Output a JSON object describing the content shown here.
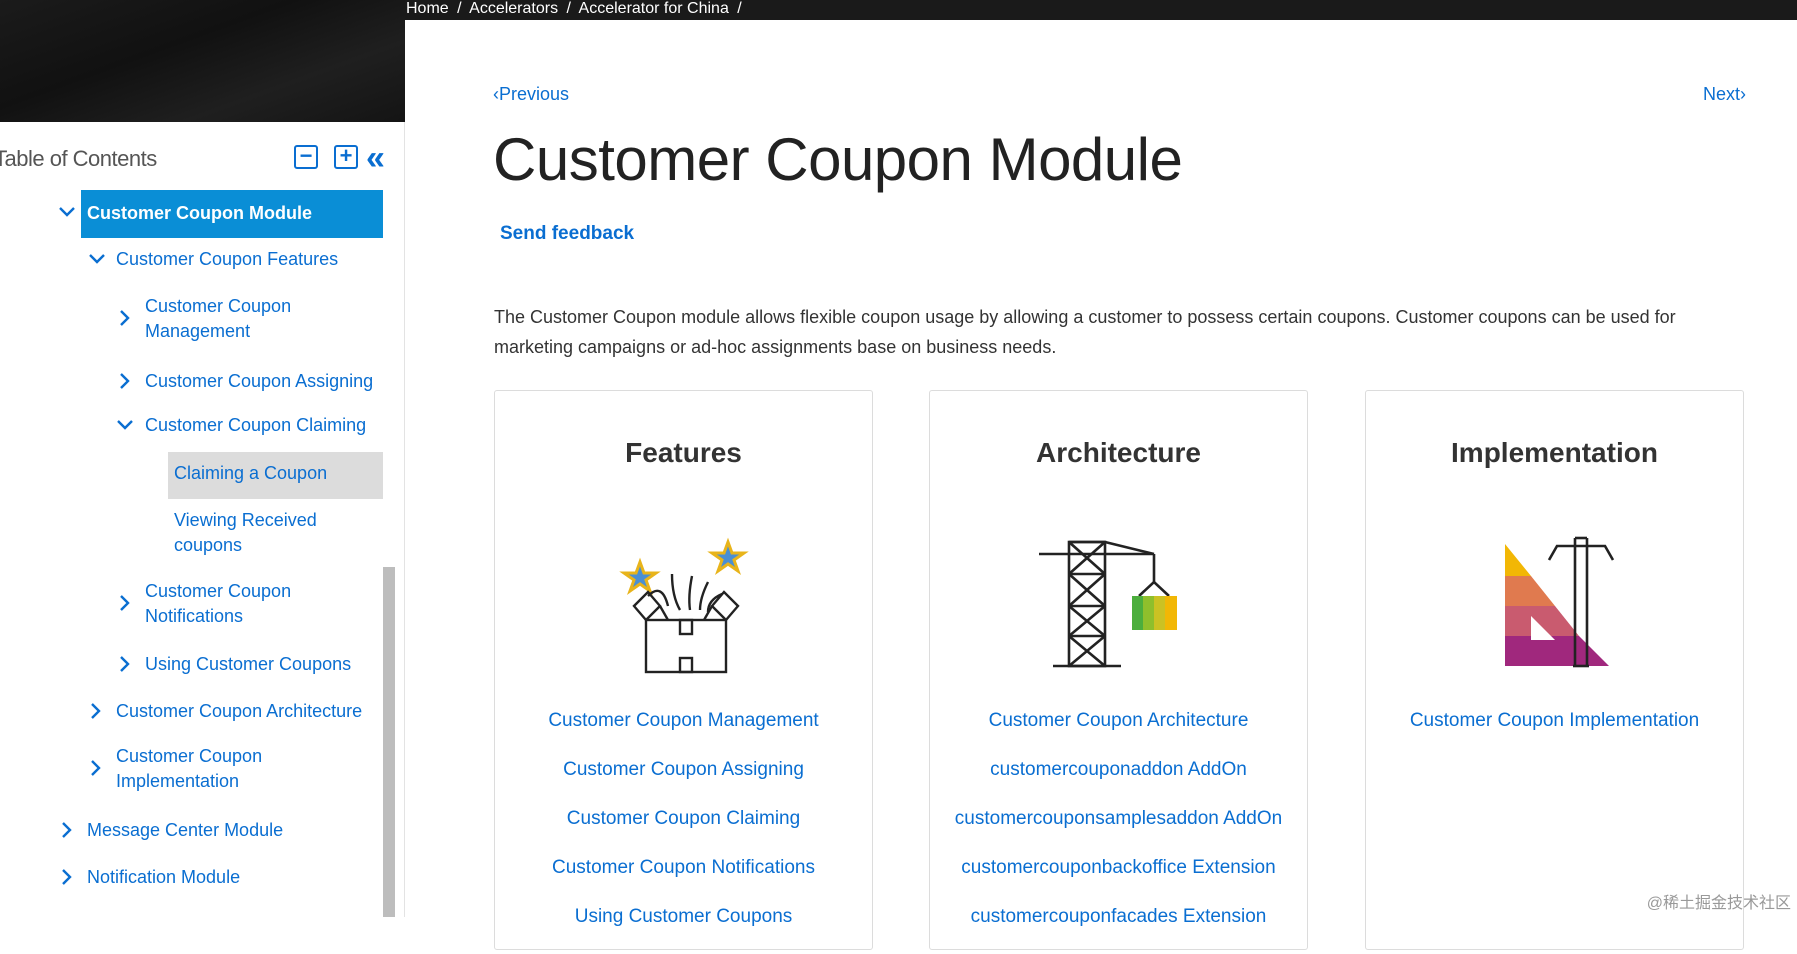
{
  "breadcrumb": [
    "Home",
    "/",
    "Accelerators",
    "/",
    "Accelerator for China",
    "/"
  ],
  "toc": {
    "title": "Table of Contents",
    "collapse_icon": "minus-box-icon",
    "expand_icon": "plus-box-icon",
    "hide_icon": "double-chevron-left-icon",
    "active_item": "Customer Coupon Module",
    "items": [
      {
        "label": "Customer Coupon Features"
      },
      {
        "label_line1": "Customer Coupon",
        "label_line2": "Management"
      },
      {
        "label": "Customer Coupon Assigning"
      },
      {
        "label": "Customer Coupon Claiming"
      },
      {
        "label": "Claiming a Coupon"
      },
      {
        "label_line1": "Viewing Received",
        "label_line2": "coupons"
      },
      {
        "label_line1": "Customer Coupon",
        "label_line2": "Notifications"
      },
      {
        "label": "Using Customer Coupons"
      },
      {
        "label": "Customer Coupon Architecture"
      },
      {
        "label_line1": "Customer Coupon",
        "label_line2": "Implementation"
      },
      {
        "label": "Message Center Module"
      },
      {
        "label": "Notification Module"
      }
    ]
  },
  "nav": {
    "previous": "Previous",
    "next": "Next"
  },
  "page": {
    "title": "Customer Coupon Module",
    "feedback": "Send feedback",
    "intro": "The Customer Coupon module allows flexible coupon usage by allowing a customer to possess certain coupons. Customer coupons can be used for marketing campaigns or ad-hoc assignments base on business needs."
  },
  "cards": {
    "features": {
      "title": "Features",
      "icon": "gift-box-stars-icon",
      "links": [
        "Customer Coupon Management",
        "Customer Coupon Assigning",
        "Customer Coupon Claiming",
        "Customer Coupon Notifications",
        "Using Customer Coupons"
      ]
    },
    "architecture": {
      "title": "Architecture",
      "icon": "crane-icon",
      "links": [
        "Customer Coupon Architecture",
        "customercouponaddon AddOn",
        "customercouponsamplesaddon AddOn",
        "customercouponbackoffice Extension",
        "customercouponfacades Extension"
      ]
    },
    "implementation": {
      "title": "Implementation",
      "icon": "ruler-triangle-icon",
      "links": [
        "Customer Coupon Implementation"
      ]
    }
  },
  "watermark": "@稀土掘金技术社区",
  "colors": {
    "link": "#0a6ed1",
    "active_bg": "#0a8ed6",
    "selected_bg": "#dcdcdc"
  }
}
